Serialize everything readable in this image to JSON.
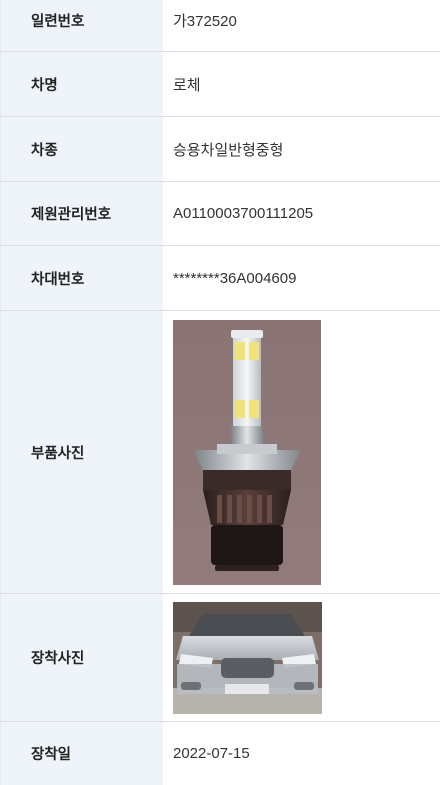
{
  "rows": [
    {
      "label": "일련번호",
      "value": "가372520"
    },
    {
      "label": "차명",
      "value": "로체"
    },
    {
      "label": "차종",
      "value": "승용차일반형중형"
    },
    {
      "label": "제원관리번호",
      "value": "A0110003700111205"
    },
    {
      "label": "차대번호",
      "value": "********36A004609"
    },
    {
      "label": "부품사진",
      "image": "led-headlight-bulb-photo"
    },
    {
      "label": "장착사진",
      "image": "silver-sedan-front-photo"
    },
    {
      "label": "장착일",
      "value": "2022-07-15"
    }
  ],
  "colors": {
    "label_bg": "#eef4f9",
    "divider": "#dcdfe4",
    "photo_bg": "#8d7878"
  }
}
